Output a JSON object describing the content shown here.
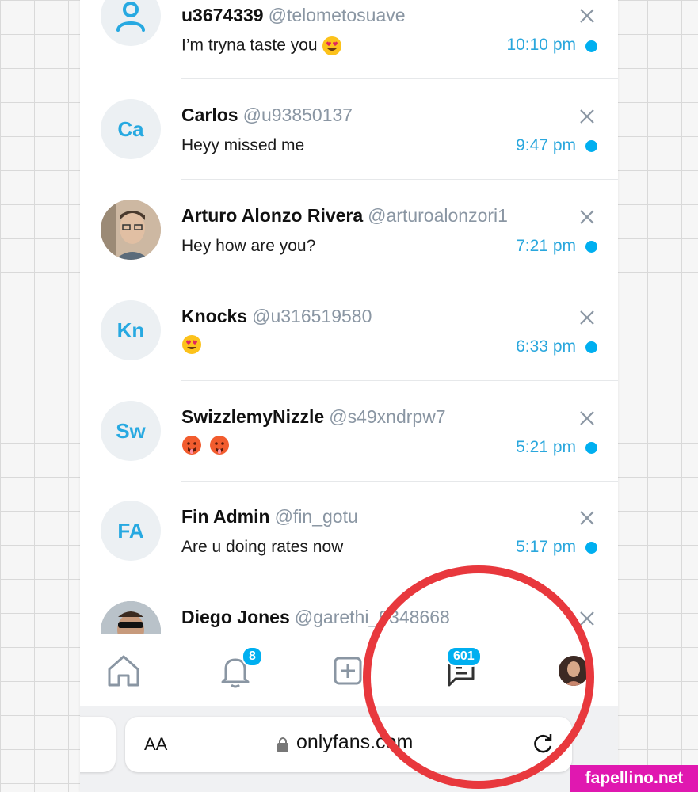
{
  "chats": [
    {
      "name": "u3674339",
      "handle": "@telometosuave",
      "message": "I’m tryna taste you",
      "emojis": [
        "heart-eyes"
      ],
      "time": "10:10 pm",
      "avatar": {
        "type": "icon",
        "icon": "user-icon"
      },
      "unread": true
    },
    {
      "name": "Carlos",
      "handle": "@u93850137",
      "message": "Heyy missed me",
      "emojis": [],
      "time": "9:47 pm",
      "avatar": {
        "type": "initials",
        "initials": "Ca"
      },
      "unread": true
    },
    {
      "name": "Arturo Alonzo Rivera",
      "handle": "@arturoalonzori1",
      "message": "Hey how are you?",
      "emojis": [],
      "time": "7:21 pm",
      "avatar": {
        "type": "photo"
      },
      "unread": true
    },
    {
      "name": "Knocks",
      "handle": "@u316519580",
      "message": "",
      "emojis": [
        "heart-eyes"
      ],
      "time": "6:33 pm",
      "avatar": {
        "type": "initials",
        "initials": "Kn"
      },
      "unread": true
    },
    {
      "name": "SwizzlemyNizzle",
      "handle": "@s49xndrpw7",
      "message": "",
      "emojis": [
        "hot-face",
        "hot-face"
      ],
      "time": "5:21 pm",
      "avatar": {
        "type": "initials",
        "initials": "Sw"
      },
      "unread": true
    },
    {
      "name": "Fin Admin",
      "handle": "@fin_gotu",
      "message": "Are u doing rates now",
      "emojis": [],
      "time": "5:17 pm",
      "avatar": {
        "type": "initials",
        "initials": "FA"
      },
      "unread": true
    },
    {
      "name": "Diego Jones",
      "handle": "@garethi_9348668",
      "message": "",
      "emojis": [],
      "time": "",
      "avatar": {
        "type": "photo"
      },
      "unread": false
    }
  ],
  "tab_bar": {
    "notifications_badge": "8",
    "messages_badge": "601"
  },
  "browser": {
    "text_size_label": "AA",
    "url": "onlyfans.com"
  },
  "colors": {
    "accent": "#00aff0",
    "time": "#2aa7dd",
    "handle": "#8a96a3",
    "annotation": "#e8383d"
  },
  "watermark": "fapellino.net"
}
